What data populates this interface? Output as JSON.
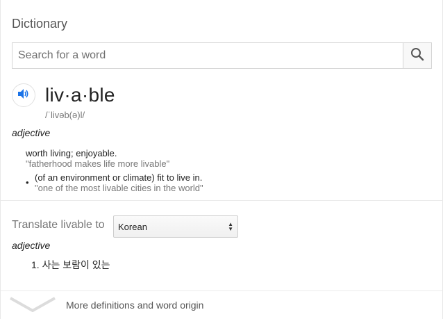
{
  "title": "Dictionary",
  "search": {
    "placeholder": "Search for a word",
    "icon": "search-icon"
  },
  "entry": {
    "speaker_icon": "speaker-icon",
    "headword": "liv·a·ble",
    "phonetic": "/ˈlivəb(ə)l/",
    "part_of_speech": "adjective",
    "definitions": [
      {
        "text": "worth living; enjoyable.",
        "example": "\"fatherhood makes life more livable\""
      },
      {
        "bullet": "•",
        "text": "(of an environment or climate) fit to live in.",
        "example": "\"one of the most livable cities in the world\""
      }
    ]
  },
  "translate": {
    "label": "Translate livable to",
    "selected_language": "Korean",
    "part_of_speech": "adjective",
    "items": [
      {
        "number": "1.",
        "text": "사는 보람이 있는"
      }
    ]
  },
  "more": {
    "label": "More definitions and word origin",
    "icon": "chevron-down-icon"
  },
  "colors": {
    "accent_blue": "#1a73e8",
    "divider": "#ebebeb",
    "muted_text": "#777777"
  }
}
